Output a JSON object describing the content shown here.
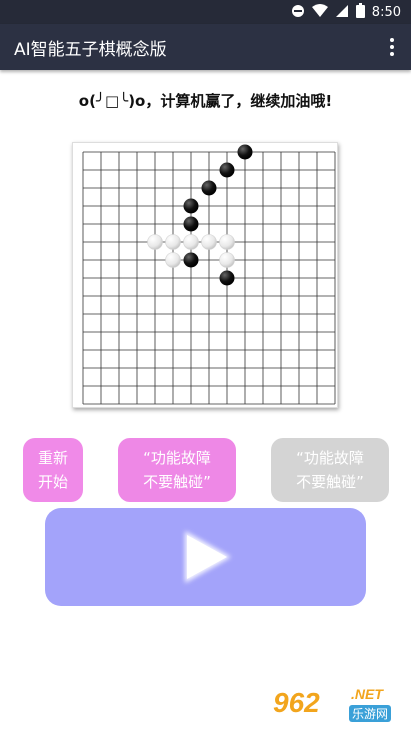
{
  "status_bar": {
    "time": "8:50"
  },
  "app_bar": {
    "title": "AI智能五子棋概念版"
  },
  "message": "o(╯□╰)o，计算机赢了，继续加油哦!",
  "board": {
    "size": 15,
    "black_stones": [
      [
        9,
        0
      ],
      [
        8,
        1
      ],
      [
        7,
        2
      ],
      [
        6,
        3
      ],
      [
        6,
        4
      ],
      [
        6,
        6
      ],
      [
        8,
        7
      ]
    ],
    "white_stones": [
      [
        4,
        5
      ],
      [
        5,
        5
      ],
      [
        6,
        5
      ],
      [
        7,
        5
      ],
      [
        8,
        5
      ],
      [
        5,
        6
      ],
      [
        8,
        6
      ]
    ]
  },
  "buttons": {
    "restart": [
      "重新",
      "开始"
    ],
    "feature1": [
      "“功能故障",
      "不要触碰”"
    ],
    "feature2": [
      "“功能故障",
      "不要触碰”"
    ]
  },
  "watermark": {
    "badge": "962",
    "domain": ".NET",
    "subtitle": "乐游网"
  }
}
